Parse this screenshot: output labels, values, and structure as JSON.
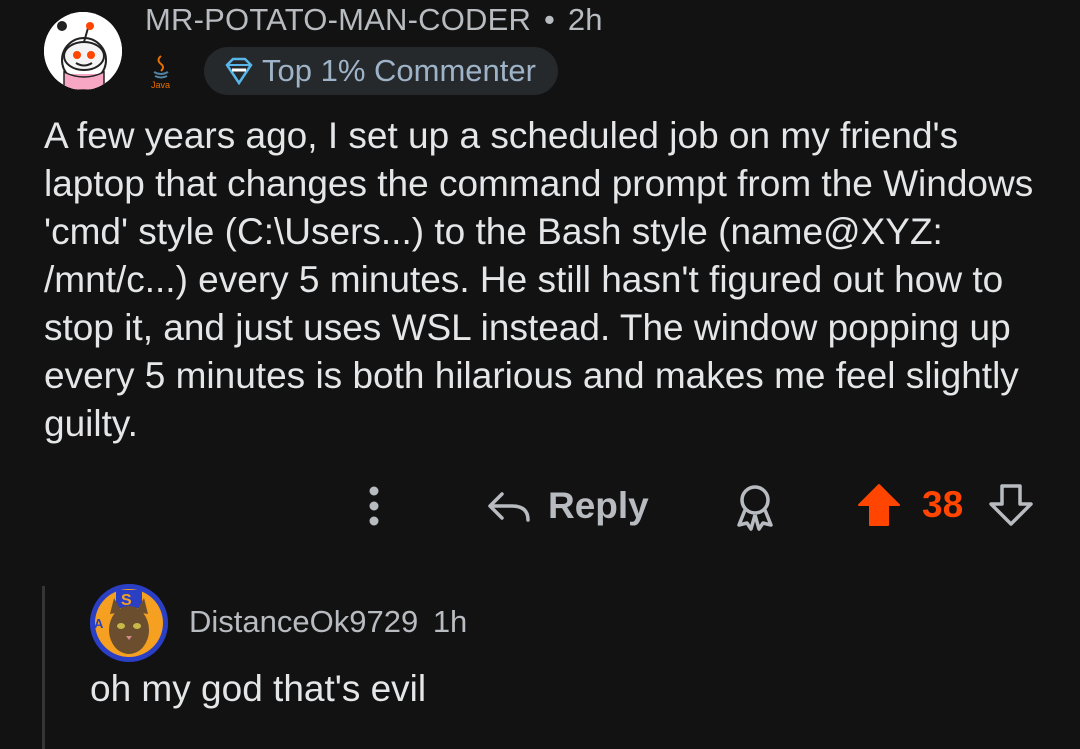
{
  "comment": {
    "author": "MR-POTATO-MAN-CODER",
    "separator": "•",
    "time": "2h",
    "flair_icon": "java-logo-icon",
    "badge_label": "Top 1% Commenter",
    "body": "A few years ago, I set up a scheduled job on my friend's laptop that changes the command prompt from the Windows 'cmd' style (C:\\Users...) to the Bash style (name@XYZ: /mnt/c...) every 5 minutes. He still hasn't figured out how to stop it, and just uses WSL instead. The window popping up every 5 minutes is both hilarious and makes me feel slightly guilty.",
    "actions": {
      "more_icon": "vertical-ellipsis-icon",
      "reply_label": "Reply",
      "award_icon": "award-icon",
      "vote_count": "38",
      "upvoted": true
    }
  },
  "reply": {
    "author": "DistanceOk9729",
    "time": "1h",
    "body": "oh my god that's evil"
  },
  "colors": {
    "background": "#121212",
    "upvote": "#ff4500",
    "badge_bg": "#25292c"
  }
}
